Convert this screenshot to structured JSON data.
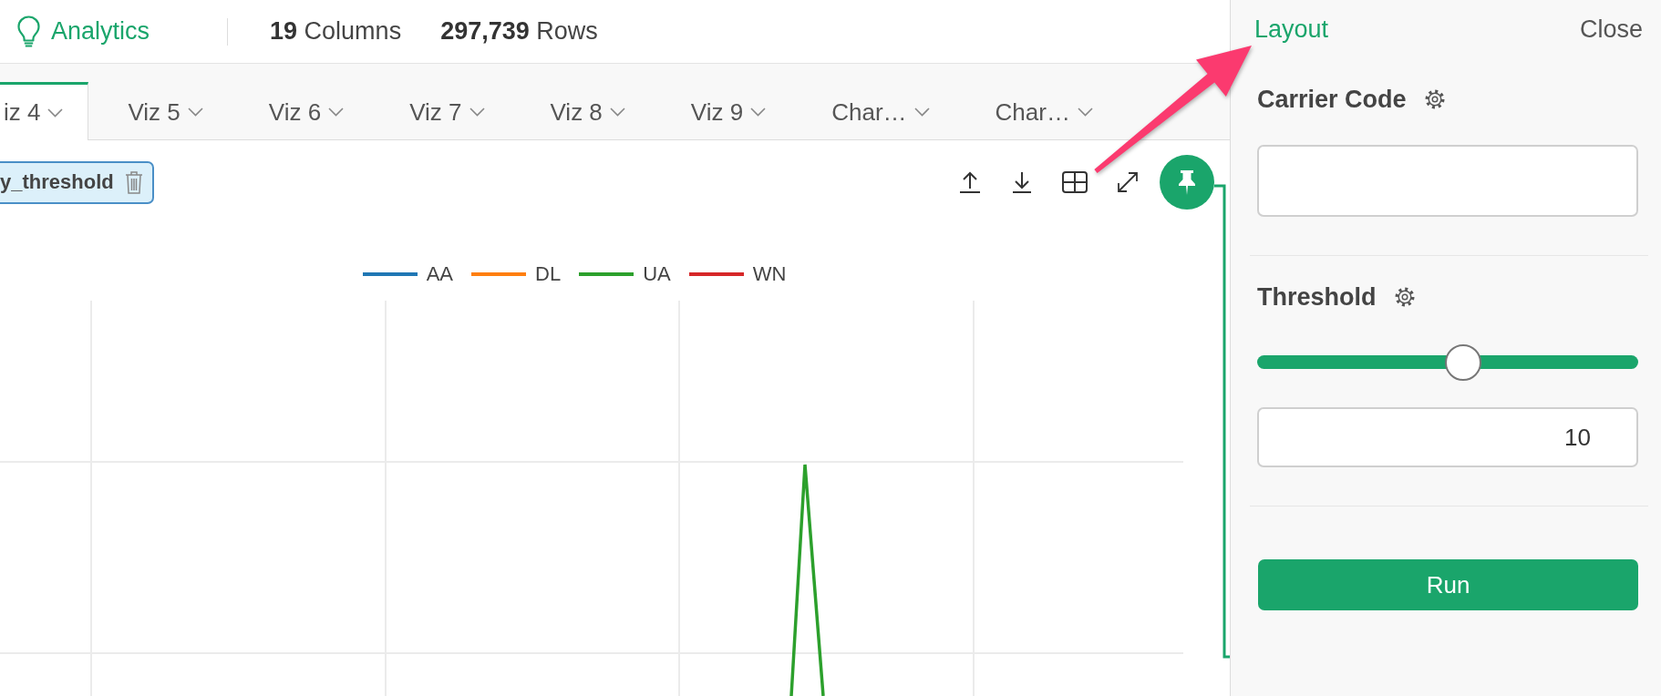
{
  "header": {
    "app_name": "Analytics",
    "columns": "**19** Columns",
    "rows": "**297,739** Rows"
  },
  "tabs": [
    {
      "label": "iz 4",
      "selected": true
    },
    {
      "label": "Viz 5",
      "selected": false
    },
    {
      "label": "Viz 6",
      "selected": false
    },
    {
      "label": "Viz 7",
      "selected": false
    },
    {
      "label": "Viz 8",
      "selected": false
    },
    {
      "label": "Viz 9",
      "selected": false
    },
    {
      "label": "Char…",
      "selected": false
    },
    {
      "label": "Char…",
      "selected": false
    }
  ],
  "filter_chip": {
    "label": "y_threshold"
  },
  "chart": {
    "legend": [
      {
        "label": "AA",
        "color": "#1f77b4"
      },
      {
        "label": "DL",
        "color": "#ff7f0e"
      },
      {
        "label": "UA",
        "color": "#2ca02c"
      },
      {
        "label": "WN",
        "color": "#d62728"
      }
    ]
  },
  "panel": {
    "title": "Layout",
    "close": "Close",
    "parameters": [
      {
        "kind": "text",
        "label": "Carrier Code"
      },
      {
        "kind": "slider",
        "label": "Threshold",
        "level": 0.54,
        "value": "10"
      }
    ],
    "run_button": "Run"
  }
}
